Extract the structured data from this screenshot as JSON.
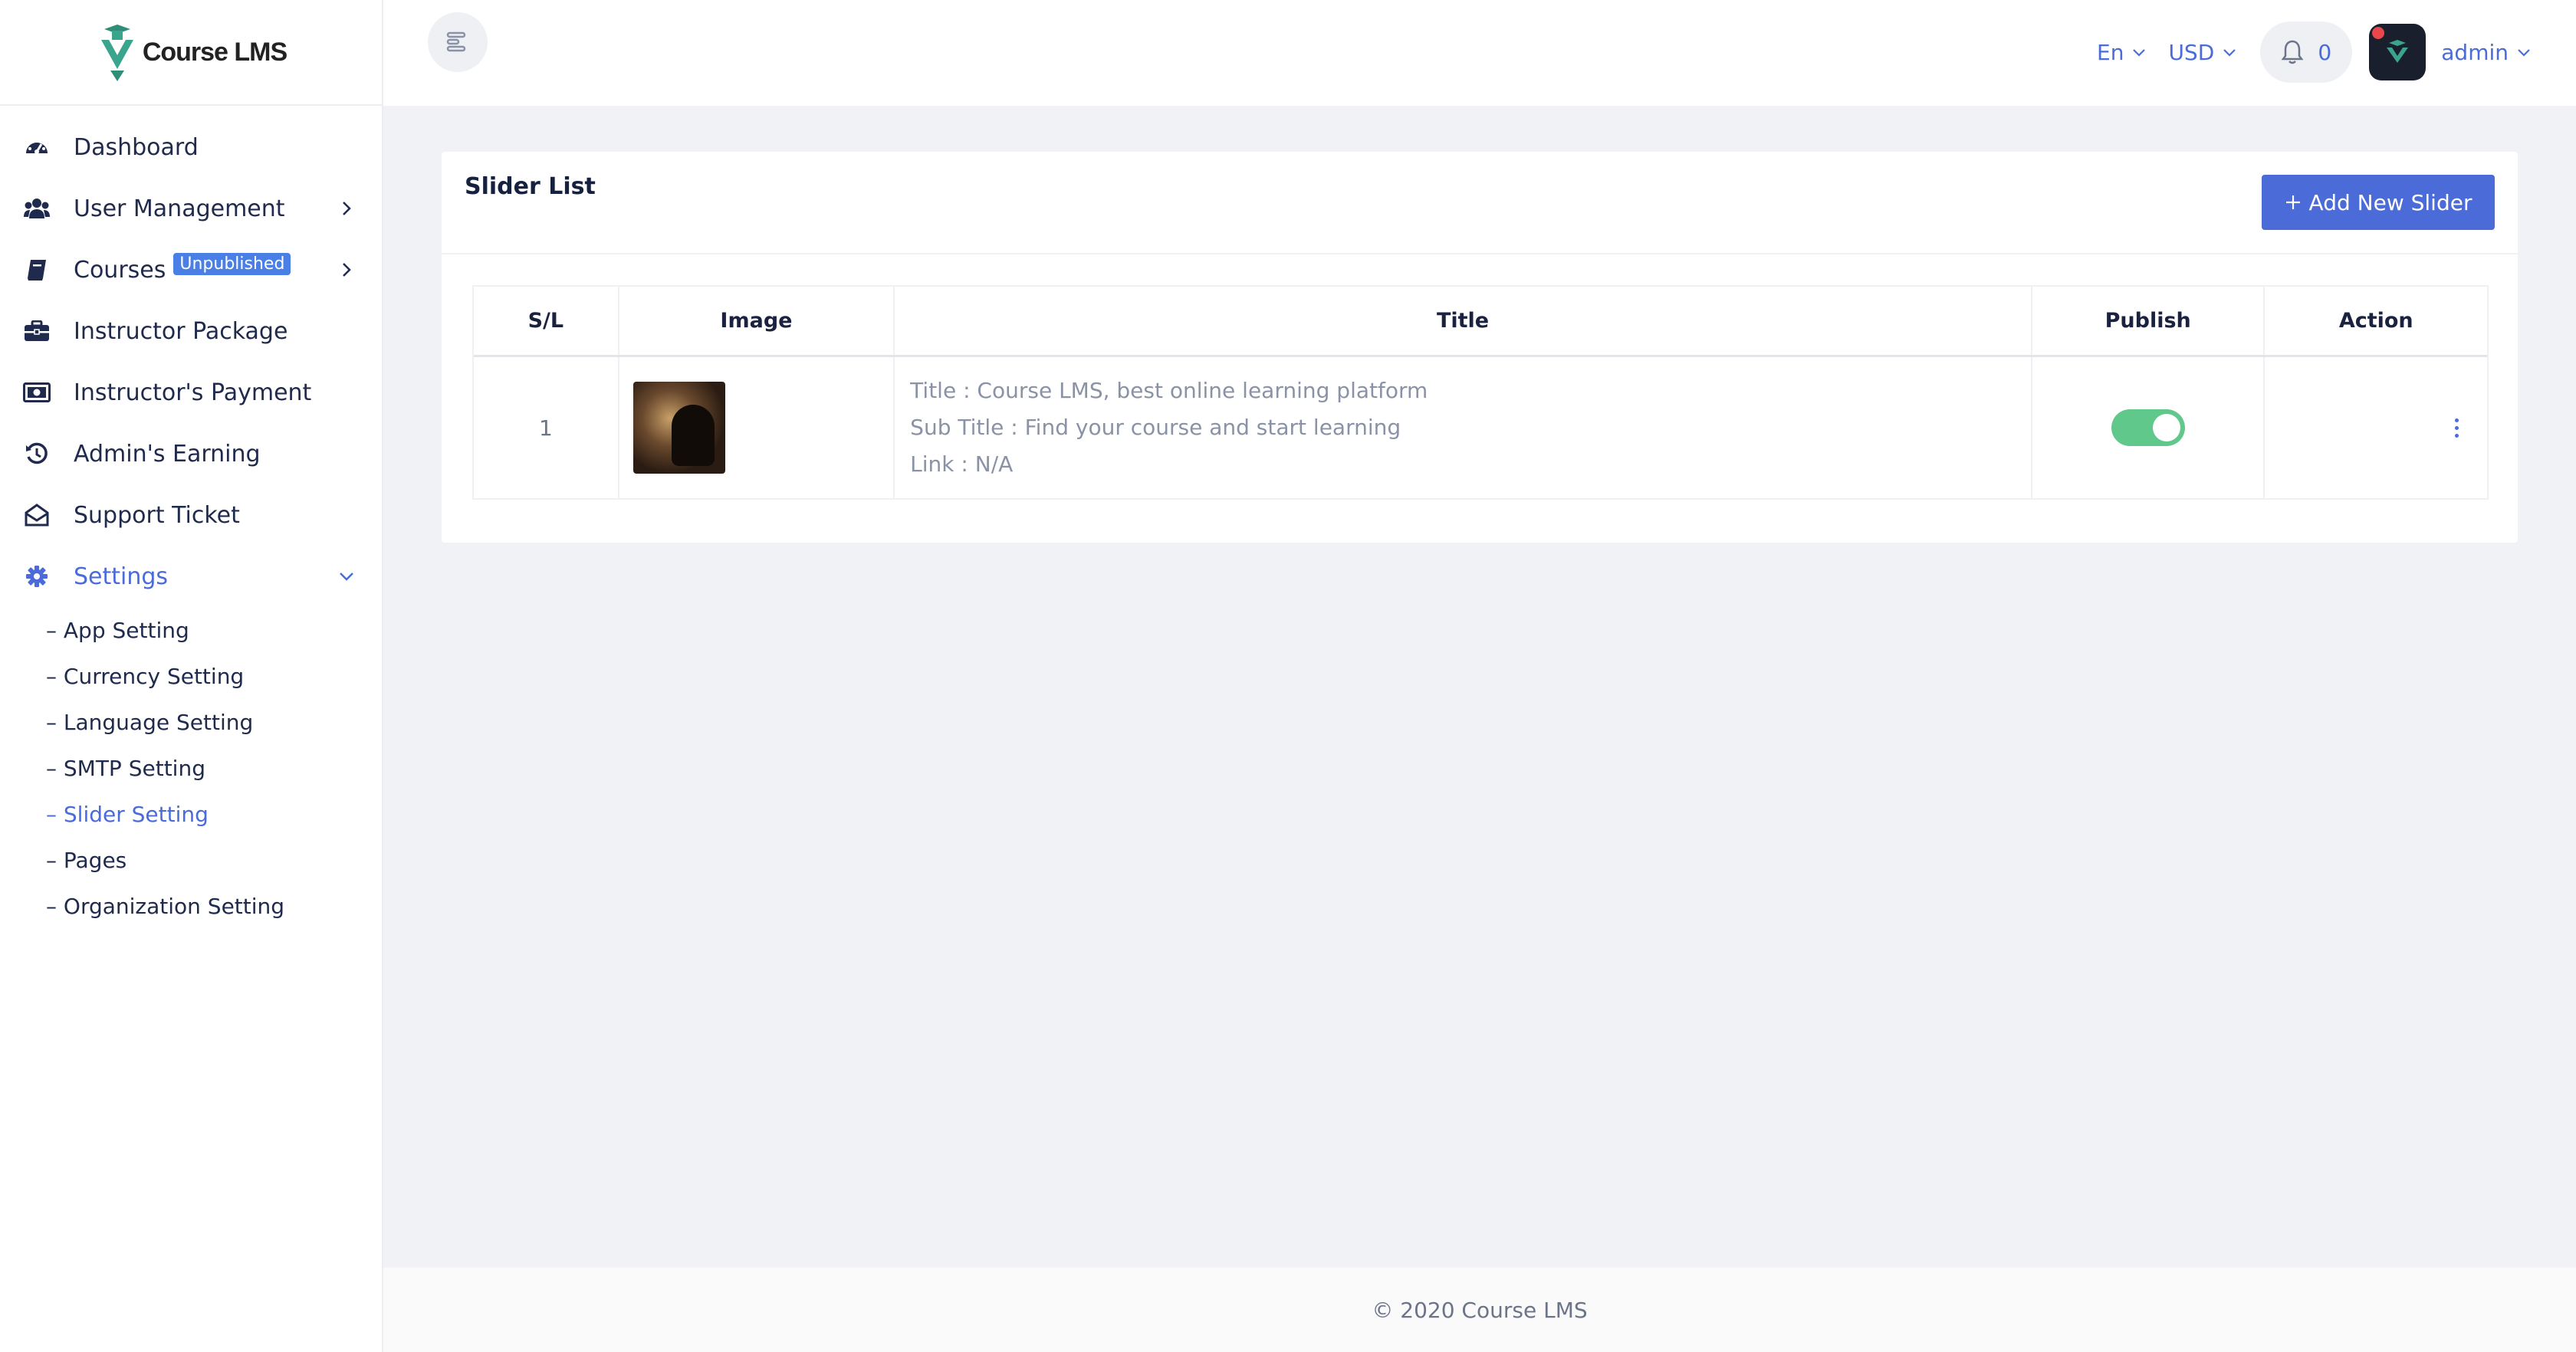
{
  "brand": {
    "name": "Course LMS"
  },
  "sidebar": {
    "items": [
      {
        "label": "Dashboard",
        "icon": "dashboard-gauge-icon"
      },
      {
        "label": "User Management",
        "icon": "users-icon"
      },
      {
        "label": "Courses",
        "icon": "book-icon",
        "badge": "Unpublished"
      },
      {
        "label": "Instructor Package",
        "icon": "briefcase-icon"
      },
      {
        "label": "Instructor's Payment",
        "icon": "money-bill-icon"
      },
      {
        "label": "Admin's Earning",
        "icon": "history-icon"
      },
      {
        "label": "Support Ticket",
        "icon": "envelope-open-icon"
      },
      {
        "label": "Settings",
        "icon": "gear-icon"
      }
    ],
    "settings_sub": [
      "– App Setting",
      "– Currency Setting",
      "– Language Setting",
      "– SMTP Setting",
      "– Slider Setting",
      "– Pages",
      "– Organization Setting"
    ],
    "active_sub": "– Slider Setting"
  },
  "topbar": {
    "language": "En",
    "currency": "USD",
    "notification_count": "0",
    "user": "admin"
  },
  "card": {
    "title": "Slider List",
    "add_button": "Add New Slider",
    "columns": [
      "S/L",
      "Image",
      "Title",
      "Publish",
      "Action"
    ],
    "rows": [
      {
        "sl": "1",
        "title": "Title : Course LMS, best online learning platform",
        "subtitle": "Sub Title : Find your course and start learning",
        "link": "Link : N/A",
        "published": true
      }
    ]
  },
  "footer": {
    "text": "© 2020 Course LMS"
  },
  "colors": {
    "accent": "#4a6bd8",
    "toggle_on": "#5fc88a",
    "badge": "#4a7fe6"
  }
}
